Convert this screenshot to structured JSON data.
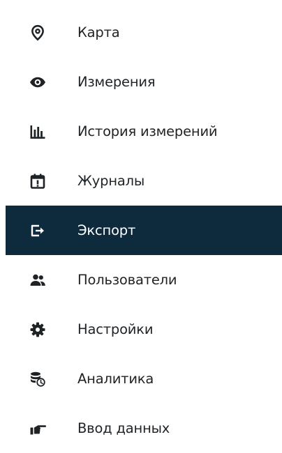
{
  "menu": {
    "items": [
      {
        "label": "Карта",
        "icon": "map-pin-icon",
        "active": false
      },
      {
        "label": "Измерения",
        "icon": "eye-icon",
        "active": false
      },
      {
        "label": "История измерений",
        "icon": "bar-chart-icon",
        "active": false
      },
      {
        "label": "Журналы",
        "icon": "calendar-alert-icon",
        "active": false
      },
      {
        "label": "Экспорт",
        "icon": "export-icon",
        "active": true
      },
      {
        "label": "Пользователи",
        "icon": "users-icon",
        "active": false
      },
      {
        "label": "Настройки",
        "icon": "gear-icon",
        "active": false
      },
      {
        "label": "Аналитика",
        "icon": "database-clock-icon",
        "active": false
      },
      {
        "label": "Ввод данных",
        "icon": "hand-point-icon",
        "active": false
      }
    ]
  },
  "colors": {
    "text": "#1f2326",
    "active_background": "#0e2a3d",
    "active_text": "#ffffff",
    "icon": "#1f2326"
  }
}
